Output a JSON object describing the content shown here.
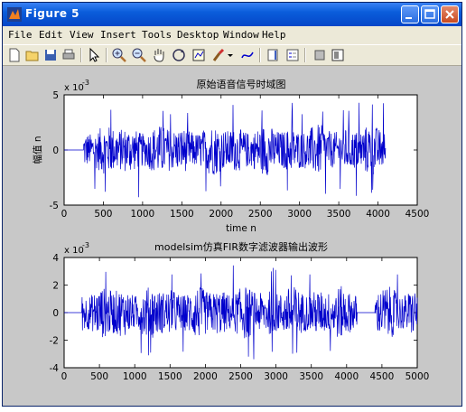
{
  "window": {
    "title": "Figure 5",
    "buttons": [
      "minimize",
      "maximize",
      "close"
    ]
  },
  "menu": [
    "File",
    "Edit",
    "View",
    "Insert",
    "Tools",
    "Desktop",
    "Window",
    "Help"
  ],
  "toolbar_icons": [
    "new-file-icon",
    "open-folder-icon",
    "save-icon",
    "print-icon",
    "arrow-select-icon",
    "zoom-in-icon",
    "zoom-out-icon",
    "pan-hand-icon",
    "rotate-3d-icon",
    "data-cursor-icon",
    "brush-icon",
    "brush-dropdown-icon",
    "link-plot-icon",
    "colorbar-icon",
    "legend-icon",
    "hide-plot-tools-icon",
    "show-plot-tools-icon"
  ],
  "colors": {
    "titlebar": "#0a5ddb",
    "line": "#0000cc",
    "figure_bg": "#c8c8c8"
  },
  "chart_data": [
    {
      "type": "line",
      "title": "原始语音信号时域图",
      "xlabel": "time n",
      "ylabel": "幅值 n",
      "exponent_label": "x 10",
      "exponent_power": "-3",
      "xlim": [
        0,
        4500
      ],
      "ylim": [
        -5,
        5
      ],
      "xticks": [
        "0",
        "500",
        "1000",
        "1500",
        "2000",
        "2500",
        "3000",
        "3500",
        "4000",
        "4500"
      ],
      "yticks": [
        "5",
        "0",
        "-5"
      ],
      "series": [
        {
          "x_start": 0,
          "x_end": 4096,
          "flat_until": 250,
          "amplitude_typical": 1.8,
          "amplitude_peak": 4.3,
          "units": "x 10^-3"
        }
      ]
    },
    {
      "type": "line",
      "title": "modelsim仿真FIR数字滤波器输出波形",
      "xlabel": "",
      "ylabel": "",
      "exponent_label": "x 10",
      "exponent_power": "-3",
      "xlim": [
        0,
        5000
      ],
      "ylim": [
        -4,
        4
      ],
      "xticks": [
        "0",
        "500",
        "1000",
        "1500",
        "2000",
        "2500",
        "3000",
        "3500",
        "4000",
        "4500",
        "5000"
      ],
      "yticks": [
        "4",
        "2",
        "0",
        "-2",
        "-4"
      ],
      "series": [
        {
          "x_start": 0,
          "x_end": 5000,
          "flat_until": 250,
          "flat_gap": [
            4150,
            4400
          ],
          "amplitude_typical": 1.5,
          "amplitude_peak": 3.5,
          "units": "x 10^-3"
        }
      ]
    }
  ]
}
